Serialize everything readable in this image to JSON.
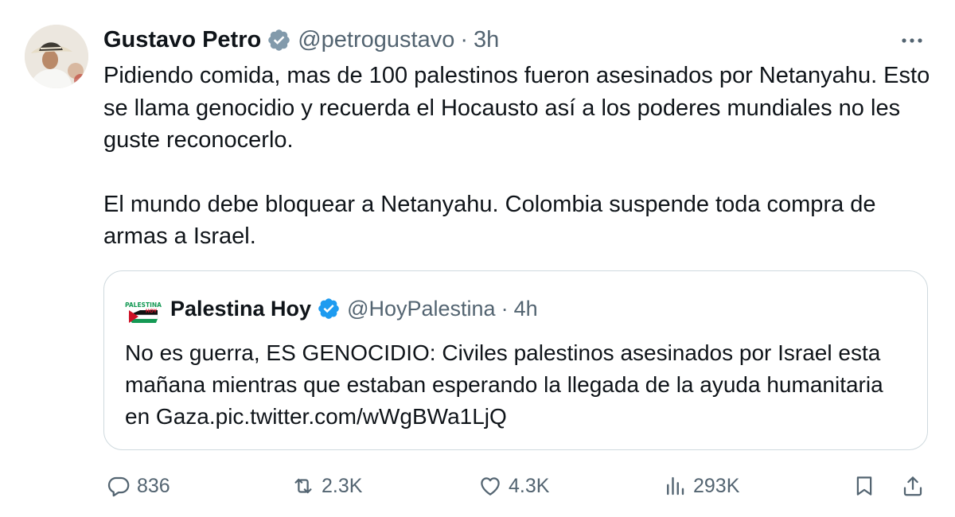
{
  "tweet": {
    "author_name": "Gustavo Petro",
    "handle": "@petrogustavo",
    "separator": "·",
    "time": "3h",
    "text_p1": "Pidiendo comida, mas de 100 palestinos fueron asesinados por Netanyahu. Esto se llama genocidio y recuerda el Hocausto así a los poderes mundiales no les guste reconocerlo.",
    "text_p2": "El mundo debe bloquear a Netanyahu. Colombia suspende toda compra de armas a Israel."
  },
  "quote": {
    "author_name": "Palestina Hoy",
    "handle": "@HoyPalestina",
    "separator": "·",
    "time": "4h",
    "text": "No es guerra, ES GENOCIDIO: Civiles palestinos asesinados por Israel esta mañana mientras que estaban esperando la llegada de la ayuda humanitaria en Gaza.pic.twitter.com/wWgBWa1LjQ",
    "avatar_logo_text": [
      "PALESTINA",
      "HOY"
    ]
  },
  "actions": {
    "replies": "836",
    "reposts": "2.3K",
    "likes": "4.3K",
    "views": "293K"
  },
  "icons": {
    "more": "more-icon",
    "verified": "verified-badge-icon",
    "reply": "reply-icon",
    "repost": "repost-icon",
    "like": "like-icon",
    "views": "views-icon",
    "bookmark": "bookmark-icon",
    "share": "share-icon"
  },
  "colors": {
    "verified": "#829aab",
    "verified_quote": "#1d9bf0",
    "text_primary": "#0f1419",
    "text_secondary": "#536471",
    "border": "#cfd9de"
  }
}
